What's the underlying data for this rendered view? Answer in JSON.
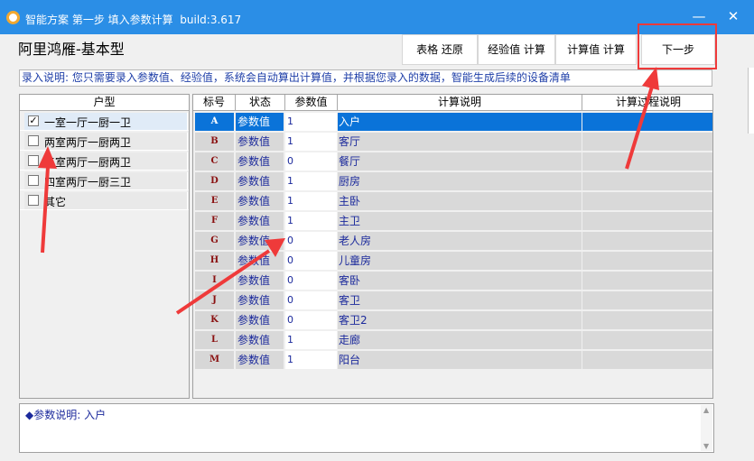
{
  "window": {
    "title": "智能方案 第一步 填入参数计算",
    "build": "build:3.617",
    "minimize_glyph": "—",
    "close_glyph": "✕"
  },
  "app_title": "阿里鸿雁-基本型",
  "toolbar": {
    "restore_label": "表格 还原",
    "experience_calc_label": "经验值 计算",
    "computed_calc_label": "计算值 计算",
    "next_label": "下一步"
  },
  "instruction": "录入说明: 您只需要录入参数值、经验值，系统会自动算出计算值，并根据您录入的数据，智能生成后续的设备清单",
  "house_types": {
    "header": "户型",
    "items": [
      {
        "label": "一室一厅一厨一卫",
        "checked": true
      },
      {
        "label": "两室两厅一厨两卫",
        "checked": false
      },
      {
        "label": "三室两厅一厨两卫",
        "checked": false
      },
      {
        "label": "四室两厅一厨三卫",
        "checked": false
      },
      {
        "label": "其它",
        "checked": false
      }
    ]
  },
  "grid": {
    "headers": {
      "key": "标号",
      "status": "状态",
      "value": "参数值",
      "description": "计算说明",
      "process": "计算过程说明"
    },
    "rows": [
      {
        "key": "A",
        "status": "参数值",
        "value": "1",
        "description": "入户",
        "process": "",
        "selected": true
      },
      {
        "key": "B",
        "status": "参数值",
        "value": "1",
        "description": "客厅",
        "process": ""
      },
      {
        "key": "C",
        "status": "参数值",
        "value": "0",
        "description": "餐厅",
        "process": ""
      },
      {
        "key": "D",
        "status": "参数值",
        "value": "1",
        "description": "厨房",
        "process": ""
      },
      {
        "key": "E",
        "status": "参数值",
        "value": "1",
        "description": "主卧",
        "process": ""
      },
      {
        "key": "F",
        "status": "参数值",
        "value": "1",
        "description": "主卫",
        "process": ""
      },
      {
        "key": "G",
        "status": "参数值",
        "value": "0",
        "description": "老人房",
        "process": ""
      },
      {
        "key": "H",
        "status": "参数值",
        "value": "0",
        "description": "儿童房",
        "process": ""
      },
      {
        "key": "I",
        "status": "参数值",
        "value": "0",
        "description": "客卧",
        "process": ""
      },
      {
        "key": "J",
        "status": "参数值",
        "value": "0",
        "description": "客卫",
        "process": ""
      },
      {
        "key": "K",
        "status": "参数值",
        "value": "0",
        "description": "客卫2",
        "process": ""
      },
      {
        "key": "L",
        "status": "参数值",
        "value": "1",
        "description": "走廊",
        "process": ""
      },
      {
        "key": "M",
        "status": "参数值",
        "value": "1",
        "description": "阳台",
        "process": ""
      }
    ]
  },
  "param_description": "◆参数说明: 入户",
  "colors": {
    "titlebar": "#2b8ee6",
    "selection": "#0a73d9",
    "text_blue": "#1c2a9c",
    "key_red": "#8a1010",
    "annotation_red": "#ef3a3a"
  }
}
